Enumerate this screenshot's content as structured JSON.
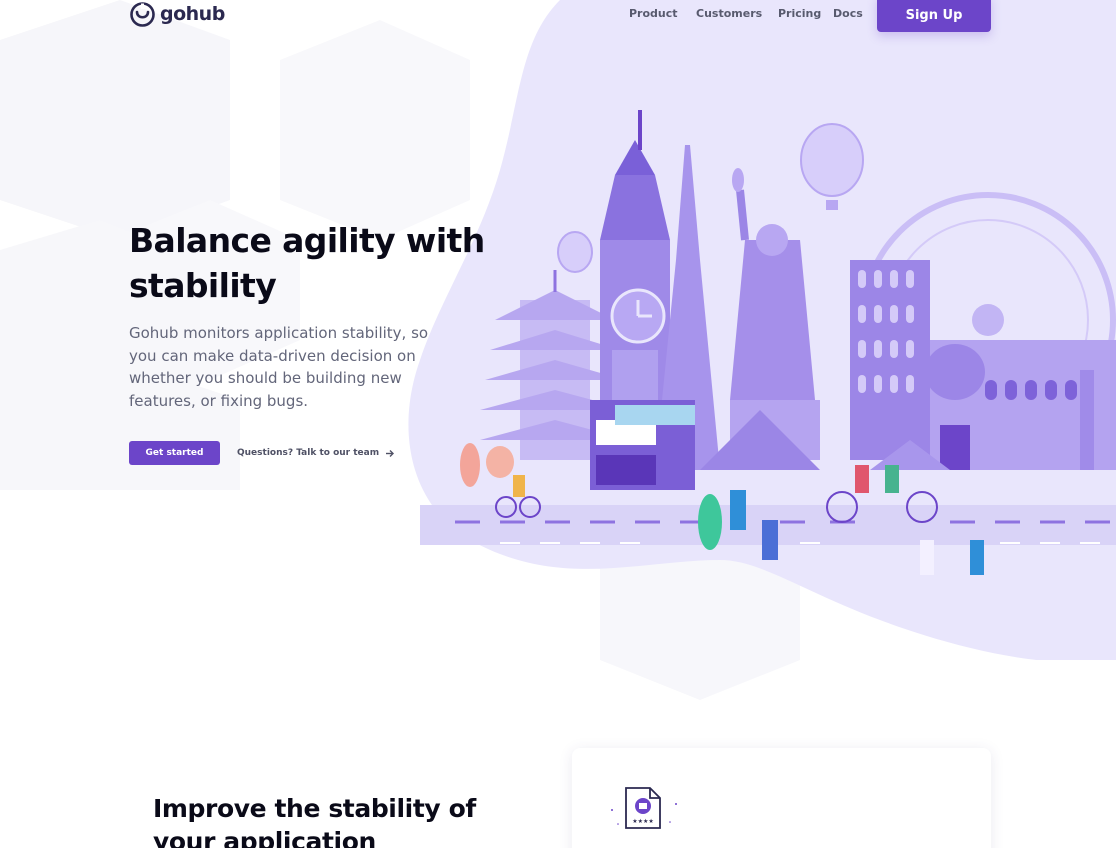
{
  "header": {
    "logo_text": "gohub",
    "nav": [
      {
        "label": "Product"
      },
      {
        "label": "Customers"
      },
      {
        "label": "Pricing"
      },
      {
        "label": "Docs"
      }
    ],
    "signup_label": "Sign Up"
  },
  "hero": {
    "title_line1": "Balance agility with",
    "title_line2": "stability",
    "description": "Gohub monitors application stability, so you can make data-driven decision on whether you should be building new features, or fixing bugs.",
    "cta_primary": "Get started",
    "cta_secondary": "Questions? Talk to our team"
  },
  "section2": {
    "title": "Improve the stability of your application"
  },
  "colors": {
    "brand": "#6c45c9",
    "heading": "#0a0a18",
    "body_text": "#63667a",
    "nav_text": "#585a6e",
    "illustration_bg": "#e7e4fb"
  },
  "icons": {
    "logo": "gohub-logo-icon",
    "arrow": "arrow-right-icon",
    "card": "report-document-icon"
  }
}
